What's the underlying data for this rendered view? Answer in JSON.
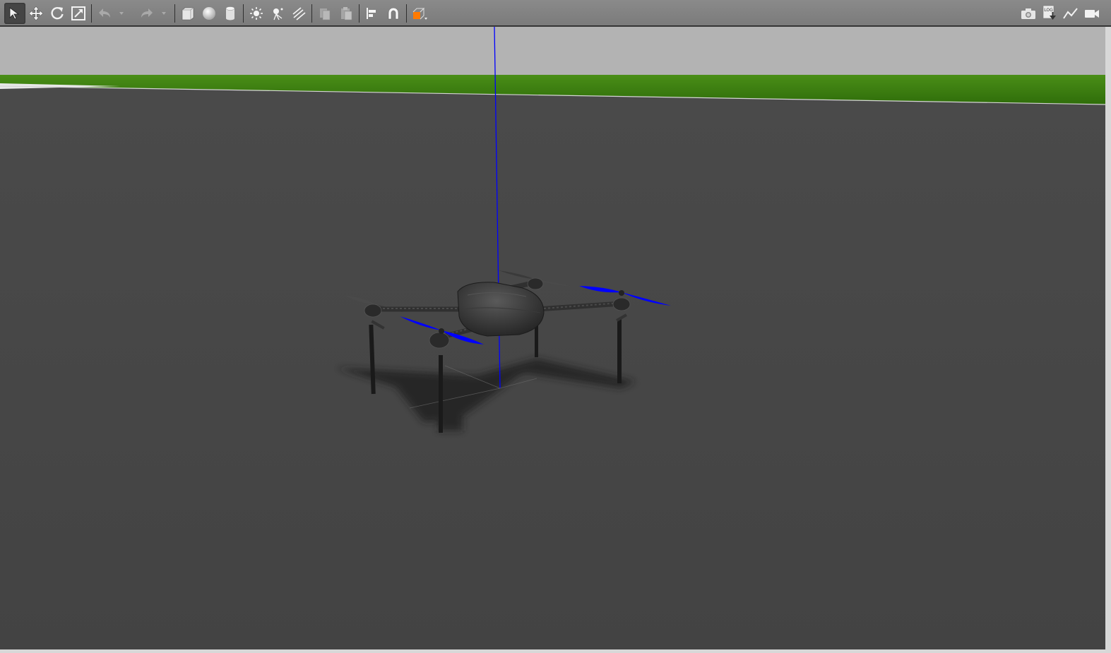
{
  "window": {
    "title": ""
  },
  "toolbar": {
    "left_tools": [
      {
        "id": "select",
        "icon": "select-arrow-icon",
        "active": true
      },
      {
        "id": "translate",
        "icon": "translate-arrows-icon",
        "active": false
      },
      {
        "id": "rotate",
        "icon": "rotate-icon",
        "active": false
      },
      {
        "id": "scale",
        "icon": "scale-icon",
        "active": false
      },
      {
        "id": "undo",
        "icon": "undo-icon",
        "active": false,
        "enabled": false
      },
      {
        "id": "undo-history",
        "icon": "chevron-down-icon",
        "enabled": false
      },
      {
        "id": "redo",
        "icon": "redo-icon",
        "active": false,
        "enabled": false
      },
      {
        "id": "redo-history",
        "icon": "chevron-down-icon",
        "enabled": false
      },
      {
        "id": "box",
        "icon": "box-shape-icon"
      },
      {
        "id": "sphere",
        "icon": "sphere-shape-icon"
      },
      {
        "id": "cylinder",
        "icon": "cylinder-shape-icon"
      },
      {
        "id": "point-light",
        "icon": "point-light-icon"
      },
      {
        "id": "spot-light",
        "icon": "spot-light-icon"
      },
      {
        "id": "directional-light",
        "icon": "directional-light-icon"
      },
      {
        "id": "copy",
        "icon": "copy-icon",
        "enabled": false
      },
      {
        "id": "paste",
        "icon": "paste-icon",
        "enabled": false
      },
      {
        "id": "align",
        "icon": "align-icon"
      },
      {
        "id": "snap",
        "icon": "magnet-snap-icon"
      },
      {
        "id": "view-angle",
        "icon": "view-angle-cube-icon"
      }
    ],
    "right_tools": [
      {
        "id": "screenshot",
        "icon": "camera-icon"
      },
      {
        "id": "log",
        "icon": "log-record-icon",
        "label": "LOG"
      },
      {
        "id": "plot",
        "icon": "plot-line-icon"
      },
      {
        "id": "video",
        "icon": "video-record-icon"
      }
    ]
  },
  "colors": {
    "toolbar_bg": "#7f7f7f",
    "sky": "#b3b3b3",
    "grass": "#3f7f11",
    "ground": "#444444",
    "propeller_blue": "#0000ff",
    "axis_blue": "#0000ff",
    "drone_body": "#2b2b2b",
    "orange_accent": "#ff7a00"
  },
  "viewport": {
    "scene": "quadcopter-on-ground-plane",
    "model": "iris-quadcopter"
  }
}
